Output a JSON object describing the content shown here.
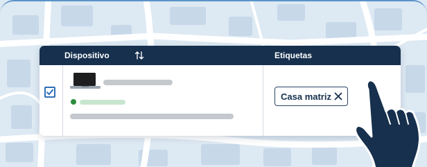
{
  "table": {
    "columns": [
      {
        "label": "Dispositivo",
        "sortable": true,
        "sort_icon": "sort-arrows-icon"
      },
      {
        "label": "Etiquetas"
      }
    ],
    "rows": [
      {
        "selected": true,
        "device_icon": "laptop-icon",
        "status_color": "#2e8b3e",
        "tag": {
          "label": "Casa matriz",
          "close_icon": "close-icon"
        }
      }
    ]
  },
  "colors": {
    "header_bg": "#16304d",
    "accent": "#2f6fb7",
    "status_online": "#2e8b3e",
    "map_bg": "#dde9f3"
  }
}
